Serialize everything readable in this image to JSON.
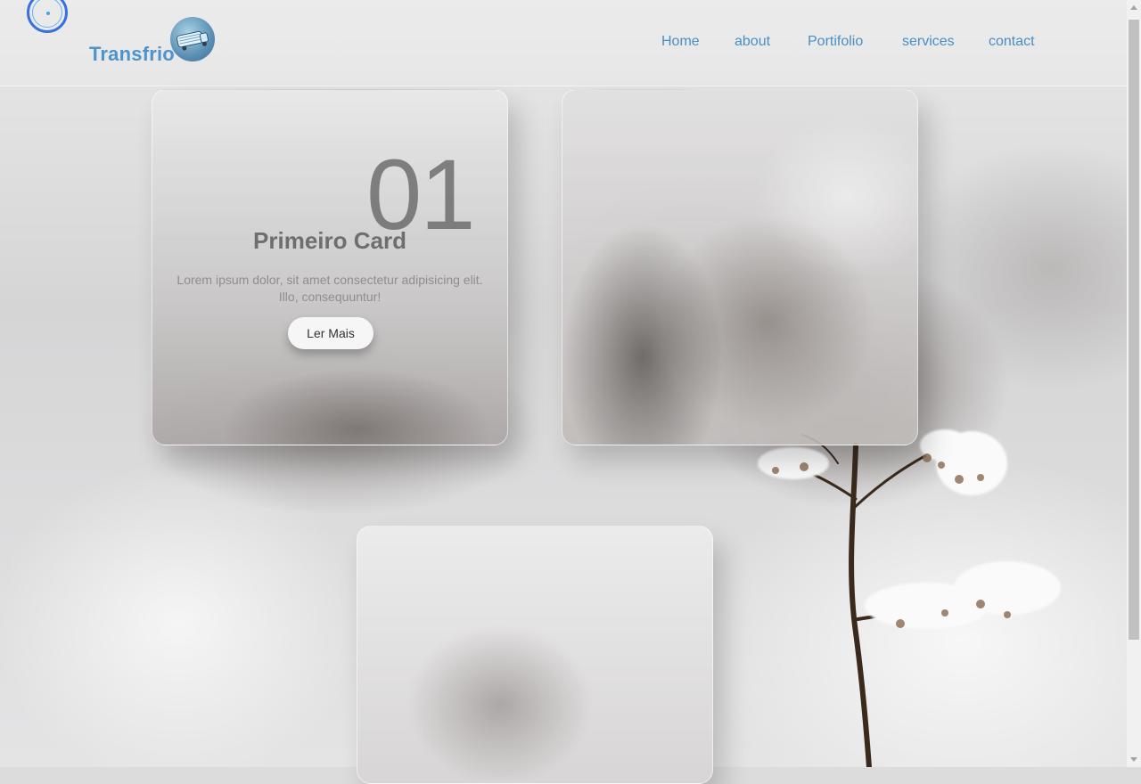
{
  "brand": {
    "name": "Transfrio"
  },
  "nav": {
    "items": [
      "Home",
      "about",
      "Portifolio",
      "services",
      "contact"
    ]
  },
  "cards": [
    {
      "number": "01",
      "title": "Primeiro Card",
      "text": "Lorem ipsum dolor, sit amet consectetur adipisicing elit. Illo, consequuntur!",
      "button_label": "Ler Mais"
    }
  ],
  "colors": {
    "brand": "#4d93cc",
    "nav_link": "#4a8ec6",
    "ring": "#3a6fe0",
    "card_number": "#5f5f5f"
  },
  "icons": {
    "top_left": "concentric-ring-icon",
    "logo": "refrigerated-truck-logo"
  }
}
